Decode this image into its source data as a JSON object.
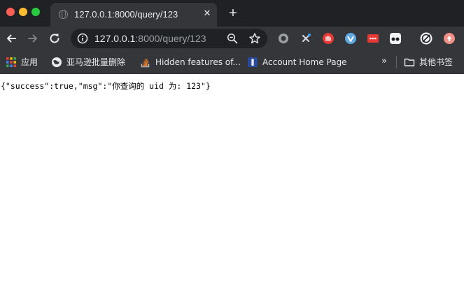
{
  "tab": {
    "title": "127.0.0.1:8000/query/123",
    "close_glyph": "✕",
    "new_tab_glyph": "+"
  },
  "omnibox": {
    "host": "127.0.0.1",
    "rest": ":8000/query/123"
  },
  "bookmarks": {
    "items": [
      {
        "label": "应用",
        "icon": "apps-grid-icon"
      },
      {
        "label": "亚马逊批量删除",
        "icon": "globe-icon"
      },
      {
        "label": "Hidden features of...",
        "icon": "stackoverflow-icon"
      },
      {
        "label": "Account Home Page",
        "icon": "account-icon"
      }
    ],
    "overflow_glyph": "»",
    "other_folder": "其他书签"
  },
  "page": {
    "body_text": "{\"success\":true,\"msg\":\"你查询的 uid 为: 123\"}"
  },
  "colors": {
    "chrome_dark": "#202124",
    "toolbar": "#35363a",
    "text_light": "#e8eaed",
    "text_muted": "#9aa0a6"
  }
}
